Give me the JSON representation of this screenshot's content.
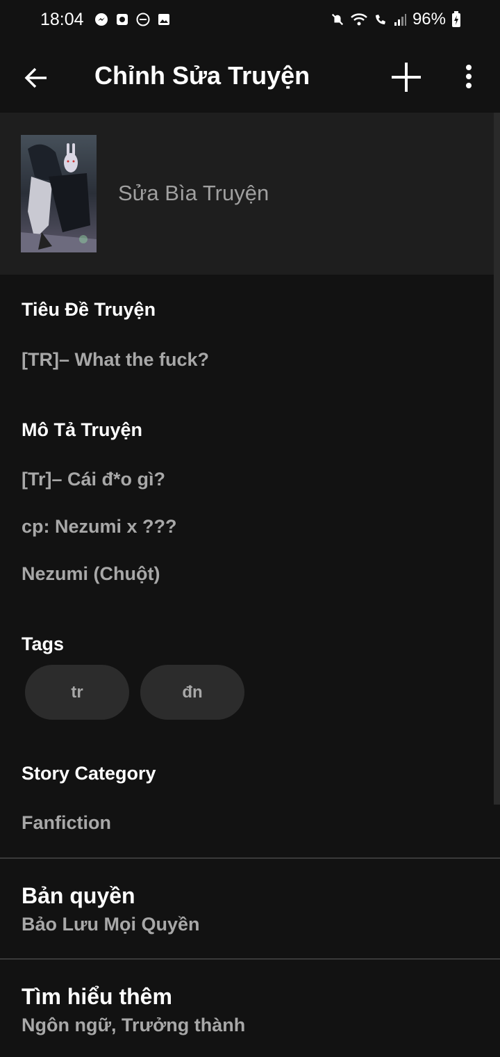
{
  "status_bar": {
    "time": "18:04",
    "battery_percent": "96%",
    "left_icons": [
      "messenger-icon",
      "app-icon",
      "dnd-icon",
      "image-icon"
    ],
    "right_icons": [
      "mute-icon",
      "wifi-icon",
      "wifi-call-icon",
      "signal-icon",
      "battery-charging-icon"
    ]
  },
  "app_bar": {
    "title": "Chỉnh Sửa Truyện"
  },
  "cover": {
    "edit_label": "Sửa Bìa Truyện"
  },
  "fields": {
    "title_label": "Tiêu Đề Truyện",
    "title_value": "[TR]– What the fuck?",
    "description_label": "Mô Tả Truyện",
    "description_lines": [
      "[Tr]– Cái đ*o gì?",
      "cp: Nezumi x ???",
      "Nezumi (Chuột)"
    ],
    "tags_label": "Tags",
    "tags": [
      "tr",
      "đn"
    ],
    "category_label": "Story Category",
    "category_value": "Fanfiction"
  },
  "rows": {
    "copyright_title": "Bản quyền",
    "copyright_value": "Bảo Lưu Mọi Quyền",
    "more_title": "Tìm hiểu thêm",
    "more_value": "Ngôn ngữ, Trưởng thành"
  },
  "colors": {
    "background": "#121212",
    "cover_section": "#1e1e1e",
    "chip": "#2c2c2c",
    "secondary_text": "#a8a8a8"
  }
}
